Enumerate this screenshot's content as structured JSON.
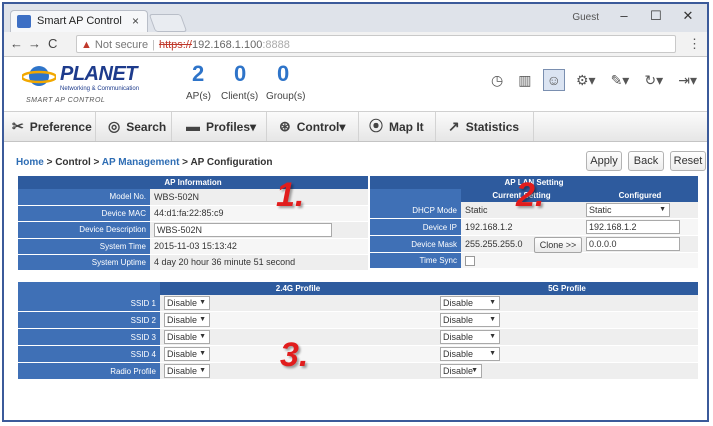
{
  "browser": {
    "tab_title": "Smart AP Control",
    "tab_close": "×",
    "user_badge": "Guest",
    "win_minimize": "–",
    "win_maximize": "☐",
    "win_close": "✕",
    "nav_back": "←",
    "nav_forward": "→",
    "nav_reload": "C",
    "warn_icon": "▲",
    "not_secure": "Not secure",
    "scheme": "https://",
    "host": "192.168.1.100",
    "port": ":8888",
    "menu_dots": "⋮"
  },
  "header": {
    "logo_text": "PLANET",
    "logo_sub": "Networking & Communication",
    "logo_tag": "SMART AP CONTROL",
    "counts": [
      {
        "value": "2",
        "label": "AP(s)"
      },
      {
        "value": "0",
        "label": "Client(s)"
      },
      {
        "value": "0",
        "label": "Group(s)"
      }
    ],
    "icons": [
      "dashboard-icon",
      "bar-chart-icon",
      "user-icon",
      "gear-icon",
      "wrench-icon",
      "refresh-icon",
      "logout-icon"
    ]
  },
  "menu": {
    "preference": "Preference",
    "search": "Search",
    "profiles": "Profiles",
    "control": "Control",
    "mapit": "Map It",
    "statistics": "Statistics"
  },
  "breadcrumb": {
    "home": "Home",
    "gt": " > ",
    "control": "Control",
    "ap_management": "AP Management",
    "current": "AP Configuration"
  },
  "actions": {
    "apply": "Apply",
    "back": "Back",
    "reset": "Reset"
  },
  "ap_info": {
    "title": "AP Information",
    "rows": [
      {
        "label": "Model No.",
        "value": "WBS-502N"
      },
      {
        "label": "Device MAC",
        "value": "44:d1:fa:22:85:c9"
      },
      {
        "label": "Device Description",
        "value": "WBS-502N"
      },
      {
        "label": "System Time",
        "value": "2015-11-03 15:13:42"
      },
      {
        "label": "System Uptime",
        "value": "4 day 20 hour 36 minute 51 second"
      }
    ]
  },
  "lan": {
    "title": "AP LAN Setting",
    "col_current": "Current Setting",
    "col_configured": "Configured",
    "clone": "Clone >>",
    "rows": [
      {
        "label": "DHCP Mode",
        "current": "Static",
        "configured": "Static"
      },
      {
        "label": "Device IP",
        "current": "192.168.1.2",
        "configured": "192.168.1.2"
      },
      {
        "label": "Device Mask",
        "current": "255.255.255.0",
        "configured": "0.0.0.0"
      },
      {
        "label": "Time Sync",
        "current": "",
        "configured": ""
      }
    ]
  },
  "profiles": {
    "col_24g": "2.4G Profile",
    "col_5g": "5G Profile",
    "rows": [
      {
        "label": "SSID 1",
        "g24": "Disable",
        "g5": "Disable"
      },
      {
        "label": "SSID 2",
        "g24": "Disable",
        "g5": "Disable"
      },
      {
        "label": "SSID 3",
        "g24": "Disable",
        "g5": "Disable"
      },
      {
        "label": "SSID 4",
        "g24": "Disable",
        "g5": "Disable"
      },
      {
        "label": "Radio Profile",
        "g24": "Disable",
        "g5": "Disable"
      }
    ]
  },
  "annotations": {
    "one": "1.",
    "two": "2.",
    "three": "3."
  }
}
